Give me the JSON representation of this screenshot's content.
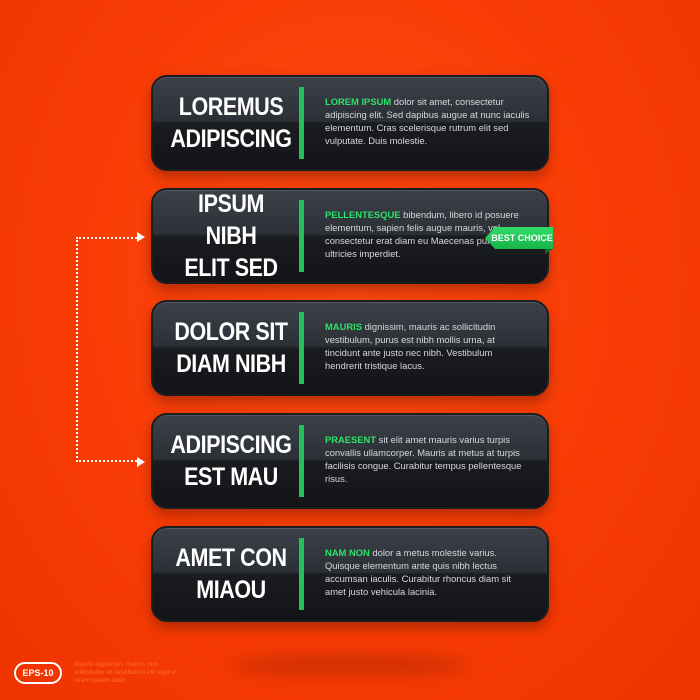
{
  "cards": [
    {
      "title_line1": "LOREMUS",
      "title_line2": "ADIPISCING",
      "keyword": "LOREM IPSUM",
      "text": " dolor sit amet, consectetur adipiscing elit. Sed dapibus augue at nunc iaculis elementum. Cras scelerisque rutrum elit sed vulputate. Duis molestie."
    },
    {
      "title_line1": "IPSUM NIBH",
      "title_line2": "ELIT SED",
      "keyword": "PELLENTESQUE",
      "text": " bibendum, libero id posuere elementum, sapien felis augue mauris, vel consectetur erat diam eu Maecenas pulvinar ultricies imperdiet."
    },
    {
      "title_line1": "DOLOR SIT",
      "title_line2": "DIAM NIBH",
      "keyword": "MAURIS",
      "text": " dignissim, mauris ac sollicitudin vestibulum, purus est nibh mollis urna, at tincidunt ante justo nec nibh. Vestibulum hendrerit tristique lacus."
    },
    {
      "title_line1": "ADIPISCING",
      "title_line2": "EST MAU",
      "keyword": "PRAESENT",
      "text": " sit elit amet mauris varius turpis convallis ullamcorper. Mauris at metus at turpis facilisis congue. Curabitur tempus pellentesque risus."
    },
    {
      "title_line1": "AMET CON",
      "title_line2": "MIAOU",
      "keyword": "NAM NON",
      "text": " dolor a metus molestie varius. Quisque elementum ante quis nibh lectus accumsan iaculis. Curabitur rhoncus diam sit amet justo vehicula lacinia."
    }
  ],
  "badge": {
    "label": "BEST CHOICE"
  },
  "footer": {
    "eps_label": "EPS-10",
    "fine_print": "Mauris dignissim, mauris non sollicitudin sit vestibulum elit eget et lorem ipsum dolor"
  },
  "colors": {
    "background": "#f93c05",
    "accent": "#21c25a",
    "card": "#2c3036"
  }
}
